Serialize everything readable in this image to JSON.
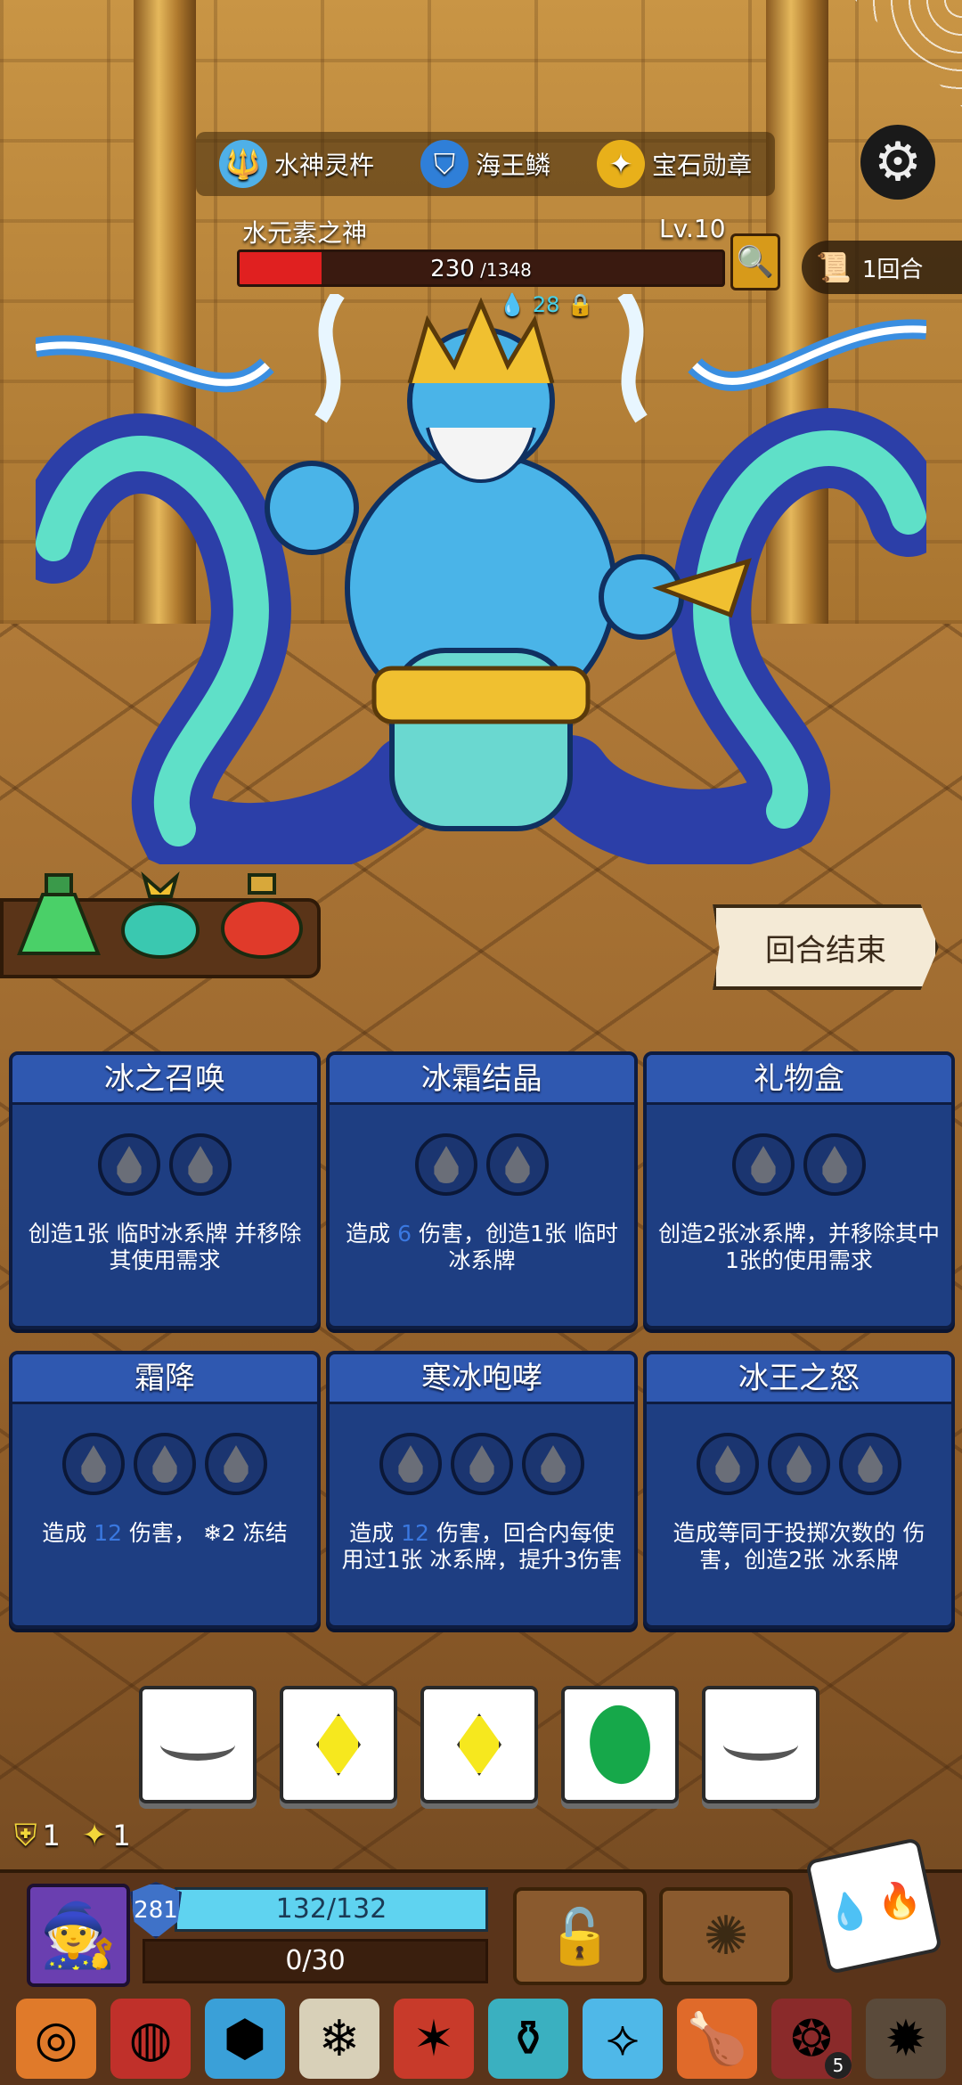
{
  "relics": [
    {
      "name": "水神灵杵",
      "icon": "trident-relic-icon",
      "color": "#4fb0e8"
    },
    {
      "name": "海王鳞",
      "icon": "scale-relic-icon",
      "color": "#2f7fd8"
    },
    {
      "name": "宝石勋章",
      "icon": "gem-medal-relic-icon",
      "color": "#e8b01a"
    }
  ],
  "enemy": {
    "name": "水元素之神",
    "level": "Lv.10",
    "hp_current": "230",
    "hp_max": " /1348",
    "hp_fraction": 0.17,
    "intent_value": "28"
  },
  "round": {
    "label": "1回合"
  },
  "end_turn_label": "回合结束",
  "cards": [
    {
      "title": "冰之召唤",
      "cost": 2,
      "desc_pre": "创造1张 临时",
      "desc_num": "",
      "desc_post": "冰系牌 并移除其使用需求"
    },
    {
      "title": "冰霜结晶",
      "cost": 2,
      "desc_pre": "造成 ",
      "desc_num": "6",
      "desc_post": " 伤害，创造1张 临时 冰系牌"
    },
    {
      "title": "礼物盒",
      "cost": 2,
      "desc_pre": "创造2张冰系牌，并移除其中1张的使用需求",
      "desc_num": "",
      "desc_post": ""
    },
    {
      "title": "霜降",
      "cost": 3,
      "desc_pre": "造成 ",
      "desc_num": "12",
      "desc_post": " 伤害， ❄2 冻结"
    },
    {
      "title": "寒冰咆哮",
      "cost": 3,
      "desc_pre": "造成 ",
      "desc_num": "12",
      "desc_post": " 伤害，回合内每使用过1张 冰系牌，提升3伤害"
    },
    {
      "title": "冰王之怒",
      "cost": 3,
      "desc_pre": "造成等同于投掷次数的 伤害，创造2张",
      "desc_num": "",
      "desc_post": " 冰系牌"
    }
  ],
  "dice_faces": [
    "eye-closed",
    "diamond",
    "diamond",
    "leaf",
    "eye-closed"
  ],
  "status": {
    "shield_count": "1",
    "star_count": "1"
  },
  "player": {
    "armor": "281",
    "hp": "132/132",
    "xp": "0/30"
  },
  "items": [
    {
      "icon": "shield-disc-item-icon",
      "color": "#e07a2a"
    },
    {
      "icon": "ring-item-icon",
      "color": "#c0302a"
    },
    {
      "icon": "pumpkin-gem-item-icon",
      "color": "#3aa0d8"
    },
    {
      "icon": "snow-scroll-item-icon",
      "color": "#d8d0b8"
    },
    {
      "icon": "jester-item-icon",
      "color": "#c83a2a"
    },
    {
      "icon": "jar-item-icon",
      "color": "#3ab0c0"
    },
    {
      "icon": "crystal-sword-item-icon",
      "color": "#4fb8e8"
    },
    {
      "icon": "meat-item-icon",
      "color": "#e06a2a"
    },
    {
      "icon": "rune-disc-item-icon",
      "color": "#8a2a2a",
      "count": "5"
    },
    {
      "icon": "beast-item-icon",
      "color": "#5a4a3a"
    }
  ],
  "colors": {
    "card_bg": "#1e3e82",
    "card_title": "#2f58b0",
    "water_blue": "#46a0e8",
    "hp_red": "#e02020"
  }
}
